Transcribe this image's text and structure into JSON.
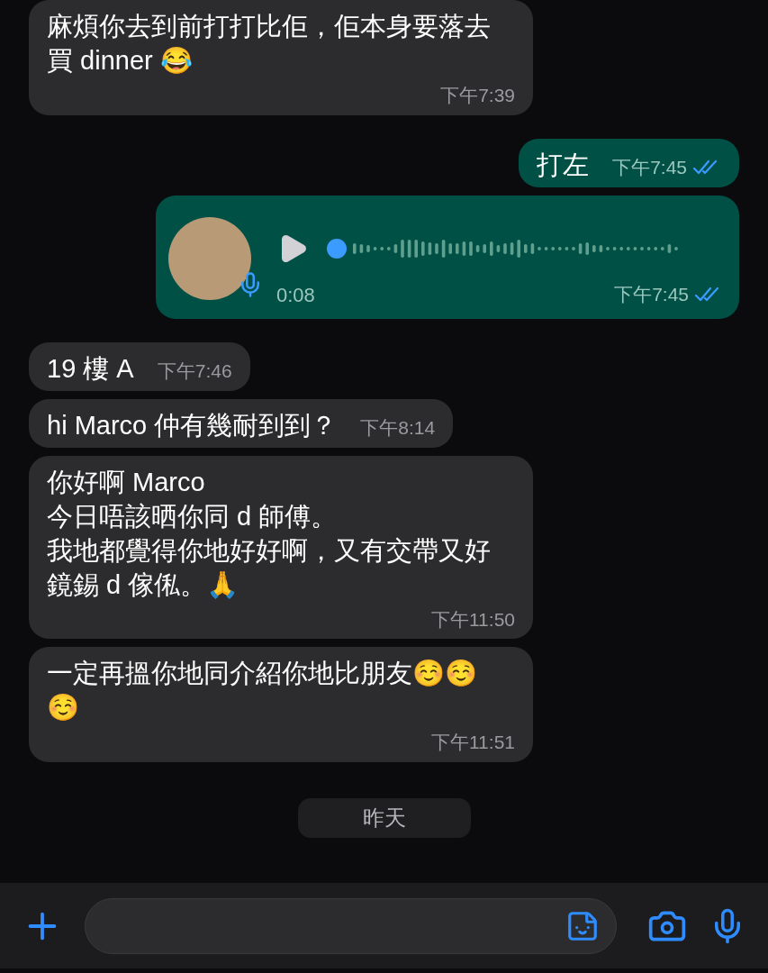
{
  "messages": [
    {
      "kind": "text",
      "outgoing": false,
      "lines": [
        "麻煩你去到前打打比佢，佢本身要落去買 dinner 😂"
      ],
      "time": "下午7:39"
    },
    {
      "kind": "text",
      "outgoing": true,
      "lines": [
        "打左"
      ],
      "time": "下午7:45",
      "read": true
    },
    {
      "kind": "voice",
      "outgoing": true,
      "duration": "0:08",
      "time": "下午7:45",
      "read": true
    },
    {
      "kind": "text",
      "outgoing": false,
      "lines": [
        "19 樓 A"
      ],
      "time": "下午7:46"
    },
    {
      "kind": "text",
      "outgoing": false,
      "lines": [
        "hi Marco 仲有幾耐到到？"
      ],
      "time": "下午8:14"
    },
    {
      "kind": "text",
      "outgoing": false,
      "lines": [
        "你好啊 Marco",
        "今日唔該晒你同 d 師傅。",
        "我地都覺得你地好好啊，又有交帶又好鏡錫 d 傢俬。🙏"
      ],
      "time": "下午11:50"
    },
    {
      "kind": "text",
      "outgoing": false,
      "lines": [
        "一定再搵你地同介紹你地比朋友☺️☺️☺️"
      ],
      "time": "下午11:51"
    }
  ],
  "date_divider": "昨天"
}
